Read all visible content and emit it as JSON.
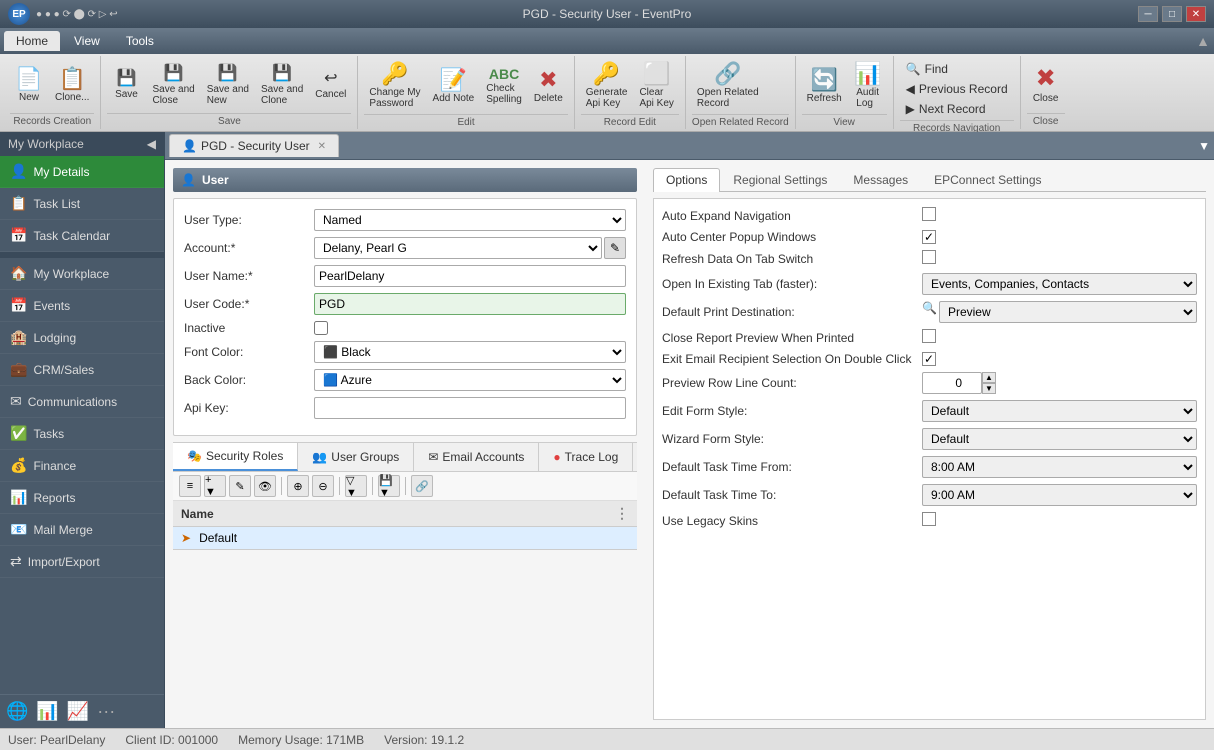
{
  "titleBar": {
    "title": "PGD - Security User - EventPro",
    "controls": [
      "minimize",
      "maximize",
      "close"
    ]
  },
  "menuBar": {
    "items": [
      {
        "id": "home",
        "label": "Home",
        "active": true
      },
      {
        "id": "view",
        "label": "View"
      },
      {
        "id": "tools",
        "label": "Tools"
      }
    ]
  },
  "toolbar": {
    "groups": [
      {
        "id": "records-creation",
        "label": "Records Creation",
        "buttons": [
          {
            "id": "new",
            "label": "New",
            "icon": "📄"
          },
          {
            "id": "clone",
            "label": "Clone...",
            "icon": "📋"
          }
        ]
      },
      {
        "id": "save",
        "label": "Save",
        "buttons": [
          {
            "id": "save",
            "label": "Save",
            "icon": "💾"
          },
          {
            "id": "save-close",
            "label": "Save and Close",
            "icon": "💾"
          },
          {
            "id": "save-new",
            "label": "Save and New",
            "icon": "💾"
          },
          {
            "id": "save-clone",
            "label": "Save and Clone",
            "icon": "💾"
          },
          {
            "id": "cancel",
            "label": "Cancel",
            "icon": "↩"
          }
        ]
      },
      {
        "id": "edit",
        "label": "Edit",
        "buttons": [
          {
            "id": "change-password",
            "label": "Change My Password",
            "icon": "🔑"
          },
          {
            "id": "add-note",
            "label": "Add Note",
            "icon": "📝"
          },
          {
            "id": "check-spelling",
            "label": "Check Spelling",
            "icon": "ABC"
          },
          {
            "id": "delete",
            "label": "Delete",
            "icon": "✖"
          }
        ]
      },
      {
        "id": "record-edit",
        "label": "Record Edit",
        "buttons": [
          {
            "id": "generate-api",
            "label": "Generate Api Key",
            "icon": "🔑"
          },
          {
            "id": "clear-api",
            "label": "Clear Api Key",
            "icon": "⬜"
          }
        ]
      },
      {
        "id": "open-related",
        "label": "Open Related Record",
        "buttons": [
          {
            "id": "open-related",
            "label": "Open Related Record",
            "icon": "🔗"
          }
        ]
      },
      {
        "id": "view",
        "label": "View",
        "buttons": [
          {
            "id": "refresh",
            "label": "Refresh",
            "icon": "🔄"
          },
          {
            "id": "audit-log",
            "label": "Audit Log",
            "icon": "📊"
          }
        ]
      },
      {
        "id": "records-nav",
        "label": "Records Navigation",
        "buttons_nav": [
          {
            "id": "find",
            "label": "Find"
          },
          {
            "id": "prev-record",
            "label": "Previous Record"
          },
          {
            "id": "next-record",
            "label": "Next Record"
          }
        ]
      },
      {
        "id": "close-group",
        "label": "Close",
        "buttons": [
          {
            "id": "close",
            "label": "Close",
            "icon": "✖"
          }
        ]
      }
    ]
  },
  "sidebar": {
    "title": "My Workplace",
    "items": [
      {
        "id": "my-details",
        "label": "My Details",
        "icon": "👤",
        "active": true
      },
      {
        "id": "task-list",
        "label": "Task List",
        "icon": "📋"
      },
      {
        "id": "task-calendar",
        "label": "Task Calendar",
        "icon": "📅"
      },
      {
        "id": "my-workplace",
        "label": "My Workplace",
        "icon": "🏠",
        "section": true
      },
      {
        "id": "events",
        "label": "Events",
        "icon": "📅"
      },
      {
        "id": "lodging",
        "label": "Lodging",
        "icon": "🏨"
      },
      {
        "id": "crm-sales",
        "label": "CRM/Sales",
        "icon": "💼"
      },
      {
        "id": "communications",
        "label": "Communications",
        "icon": "✉"
      },
      {
        "id": "tasks",
        "label": "Tasks",
        "icon": "✅"
      },
      {
        "id": "finance",
        "label": "Finance",
        "icon": "💰"
      },
      {
        "id": "reports",
        "label": "Reports",
        "icon": "📊"
      },
      {
        "id": "mail-merge",
        "label": "Mail Merge",
        "icon": "📧"
      },
      {
        "id": "import-export",
        "label": "Import/Export",
        "icon": "⇄"
      }
    ],
    "bottomIcons": [
      "🌐",
      "📊",
      "📈",
      "..."
    ]
  },
  "tabBar": {
    "tabs": [
      {
        "id": "pgd-security-user",
        "label": "PGD - Security User",
        "active": true,
        "closeable": true
      }
    ]
  },
  "userForm": {
    "sectionTitle": "User",
    "fields": [
      {
        "id": "user-type",
        "label": "User Type:",
        "type": "select",
        "value": "Named"
      },
      {
        "id": "account",
        "label": "Account:*",
        "type": "select-with-btn",
        "value": "Delany, Pearl G"
      },
      {
        "id": "user-name",
        "label": "User Name:*",
        "type": "input",
        "value": "PearlDelany"
      },
      {
        "id": "user-code",
        "label": "User Code:*",
        "type": "input",
        "value": "PGD",
        "highlighted": true
      },
      {
        "id": "inactive",
        "label": "Inactive",
        "type": "checkbox",
        "value": false
      },
      {
        "id": "font-color",
        "label": "Font Color:",
        "type": "select-color",
        "value": "Black",
        "color": "#000000"
      },
      {
        "id": "back-color",
        "label": "Back Color:",
        "type": "select-color",
        "value": "Azure",
        "color": "#F0FFFF"
      },
      {
        "id": "api-key",
        "label": "Api Key:",
        "type": "input",
        "value": ""
      }
    ]
  },
  "optionsTabs": {
    "tabs": [
      {
        "id": "options",
        "label": "Options",
        "active": true
      },
      {
        "id": "regional-settings",
        "label": "Regional Settings"
      },
      {
        "id": "messages",
        "label": "Messages"
      },
      {
        "id": "epconnect-settings",
        "label": "EPConnect Settings"
      }
    ],
    "options": [
      {
        "id": "auto-expand-nav",
        "label": "Auto Expand Navigation",
        "type": "checkbox",
        "value": false
      },
      {
        "id": "auto-center-popup",
        "label": "Auto Center Popup Windows",
        "type": "checkbox",
        "value": true
      },
      {
        "id": "refresh-data-tab",
        "label": "Refresh Data On Tab Switch",
        "type": "checkbox",
        "value": false
      },
      {
        "id": "open-existing-tab",
        "label": "Open In Existing Tab (faster):",
        "type": "select",
        "value": "Events, Companies, Contacts"
      },
      {
        "id": "default-print-dest",
        "label": "Default Print Destination:",
        "type": "select-icon",
        "value": "Preview"
      },
      {
        "id": "close-report-preview",
        "label": "Close Report Preview When Printed",
        "type": "checkbox",
        "value": false
      },
      {
        "id": "exit-email-double-click",
        "label": "Exit Email Recipient Selection On Double Click",
        "type": "checkbox",
        "value": true
      },
      {
        "id": "preview-row-line-count",
        "label": "Preview Row Line Count:",
        "type": "number",
        "value": "0"
      },
      {
        "id": "edit-form-style",
        "label": "Edit Form Style:",
        "type": "select",
        "value": "Default"
      },
      {
        "id": "wizard-form-style",
        "label": "Wizard Form Style:",
        "type": "select",
        "value": "Default"
      },
      {
        "id": "default-task-time-from",
        "label": "Default Task Time From:",
        "type": "select",
        "value": "8:00 AM"
      },
      {
        "id": "default-task-time-to",
        "label": "Default Task Time To:",
        "type": "select",
        "value": "9:00 AM"
      },
      {
        "id": "use-legacy-skins",
        "label": "Use Legacy Skins",
        "type": "checkbox",
        "value": false
      }
    ]
  },
  "bottomTabs": {
    "tabs": [
      {
        "id": "security-roles",
        "label": "Security Roles",
        "icon": "🎭",
        "active": true
      },
      {
        "id": "user-groups",
        "label": "User Groups",
        "icon": "👥"
      },
      {
        "id": "email-accounts",
        "label": "Email Accounts",
        "icon": "✉"
      },
      {
        "id": "trace-log",
        "label": "Trace Log",
        "icon": "🔴"
      }
    ],
    "tableColumns": [
      "Name"
    ],
    "tableRows": [
      {
        "name": "Default",
        "arrow": true
      }
    ],
    "toolbarButtons": [
      "list-view",
      "add-dropdown",
      "edit",
      "view-detail",
      "add-relation",
      "remove-relation",
      "filter-dropdown",
      "save-dropdown",
      "link"
    ]
  },
  "statusBar": {
    "user": "User: PearlDelany",
    "clientId": "Client ID: 001000",
    "memory": "Memory Usage: 171MB",
    "version": "Version: 19.1.2"
  }
}
